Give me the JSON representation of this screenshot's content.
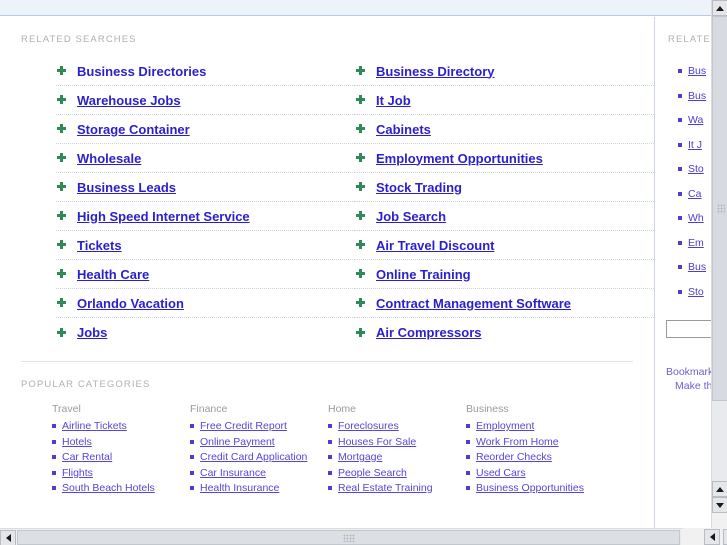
{
  "theme": {
    "link_color": "#2a1fcd",
    "small_link_color": "#5546d6",
    "bullet_green": "#2e8b57",
    "bullet_blue": "#4a3fd0",
    "label_gray": "#b0b0b0",
    "band_blue": "#eef3fa"
  },
  "main": {
    "related_searches_label": "RELATED SEARCHES",
    "popular_categories_label": "POPULAR CATEGORIES",
    "related_searches": {
      "column_left": [
        "Business Directories",
        "Warehouse Jobs",
        "Storage Container",
        "Wholesale",
        "Business Leads",
        "High Speed Internet Service",
        "Tickets",
        "Health Care",
        "Orlando Vacation",
        "Jobs"
      ],
      "column_right": [
        "Business Directory",
        "It Job",
        "Cabinets",
        "Employment Opportunities",
        "Stock Trading",
        "Job Search",
        "Air Travel Discount",
        "Online Training",
        "Contract Management Software",
        "Air Compressors"
      ]
    },
    "popular_categories": [
      {
        "heading": "Travel",
        "items": [
          "Airline Tickets",
          "Hotels",
          "Car Rental",
          "Flights",
          "South Beach Hotels"
        ]
      },
      {
        "heading": "Finance",
        "items": [
          "Free Credit Report",
          "Online Payment",
          "Credit Card Application",
          "Car Insurance",
          "Health Insurance"
        ]
      },
      {
        "heading": "Home",
        "items": [
          "Foreclosures",
          "Houses For Sale",
          "Mortgage",
          "People Search",
          "Real Estate Training"
        ]
      },
      {
        "heading": "Business",
        "items": [
          "Employment",
          "Work From Home",
          "Reorder Checks",
          "Used Cars",
          "Business Opportunities"
        ]
      }
    ]
  },
  "sidebar": {
    "label": "RELATED",
    "items": [
      "Bus",
      "Bus",
      "Wa",
      "It J",
      "Sto",
      "Ca",
      "Wh",
      "Em",
      "Bus",
      "Sto"
    ],
    "search_value": "",
    "search_placeholder": "",
    "footer_lines": [
      "Bookmark",
      "Make this"
    ]
  },
  "scrollbars": {
    "vertical_up_icon": "arrow-up-icon",
    "vertical_down_icon": "arrow-down-icon",
    "horizontal_left_icon": "arrow-left-icon",
    "horizontal_right_icon": "arrow-right-icon"
  }
}
